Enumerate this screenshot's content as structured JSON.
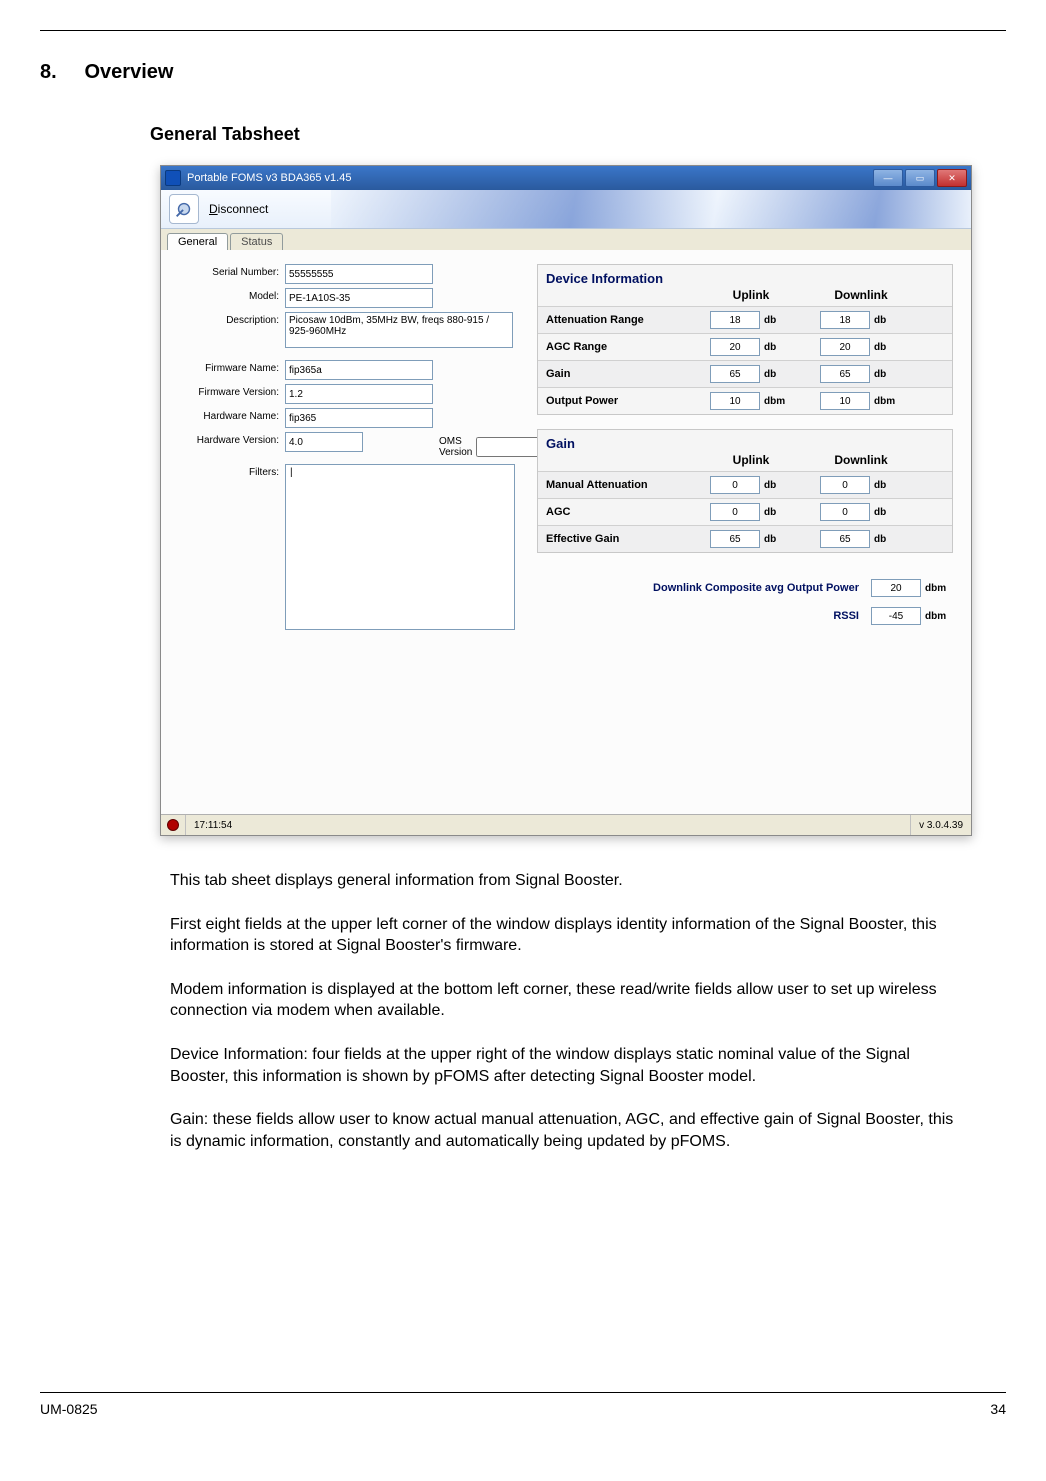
{
  "doc": {
    "section_num": "8.",
    "section_title": "Overview",
    "subsection": "General Tabsheet",
    "paragraphs": [
      "This tab sheet displays general information from Signal Booster.",
      "First eight fields at the upper left corner of the window displays identity information of the Signal Booster, this information is stored at Signal Booster's firmware.",
      "Modem information is displayed at the bottom left corner, these read/write fields allow user to set up wireless connection via modem when available.",
      "Device Information: four fields at the upper right of the window displays static nominal value of the Signal Booster, this information is shown by pFOMS after detecting Signal Booster model.",
      "Gain: these fields allow user to know actual manual attenuation, AGC, and effective gain of Signal Booster, this is dynamic information, constantly and automatically being updated by pFOMS."
    ],
    "footer_left": "UM-0825",
    "footer_right": "34"
  },
  "app": {
    "title": "Portable FOMS v3  BDA365 v1.45",
    "disconnect": "Disconnect",
    "tabs": {
      "general": "General",
      "status": "Status"
    },
    "left": {
      "serial_label": "Serial Number:",
      "serial": "55555555",
      "model_label": "Model:",
      "model": "PE-1A10S-35",
      "desc_label": "Description:",
      "desc": "Picosaw 10dBm, 35MHz BW, freqs 880-915 / 925-960MHz",
      "fwname_label": "Firmware Name:",
      "fwname": "fip365a",
      "fwver_label": "Firmware Version:",
      "fwver": "1.2",
      "hwname_label": "Hardware Name:",
      "hwname": "fip365",
      "hwver_label": "Hardware Version:",
      "hwver": "4.0",
      "oms_label": "OMS Version",
      "oms": "",
      "filters_label": "Filters:",
      "filters": "|"
    },
    "device_info": {
      "title": "Device Information",
      "uplink_hdr": "Uplink",
      "downlink_hdr": "Downlink",
      "rows": [
        {
          "label": "Attenuation Range",
          "up": "18",
          "down": "18",
          "unit": "db"
        },
        {
          "label": "AGC Range",
          "up": "20",
          "down": "20",
          "unit": "db"
        },
        {
          "label": "Gain",
          "up": "65",
          "down": "65",
          "unit": "db"
        },
        {
          "label": "Output Power",
          "up": "10",
          "down": "10",
          "unit": "dbm"
        }
      ]
    },
    "gain": {
      "title": "Gain",
      "uplink_hdr": "Uplink",
      "downlink_hdr": "Downlink",
      "rows": [
        {
          "label": "Manual Attenuation",
          "up": "0",
          "down": "0",
          "unit": "db"
        },
        {
          "label": "AGC",
          "up": "0",
          "down": "0",
          "unit": "db"
        },
        {
          "label": "Effective Gain",
          "up": "65",
          "down": "65",
          "unit": "db"
        }
      ]
    },
    "composite": {
      "label1": "Downlink Composite avg Output Power",
      "val1": "20",
      "unit1": "dbm",
      "label2": "RSSI",
      "val2": "-45",
      "unit2": "dbm"
    },
    "status": {
      "time": "17:11:54",
      "version": "v 3.0.4.39"
    }
  }
}
